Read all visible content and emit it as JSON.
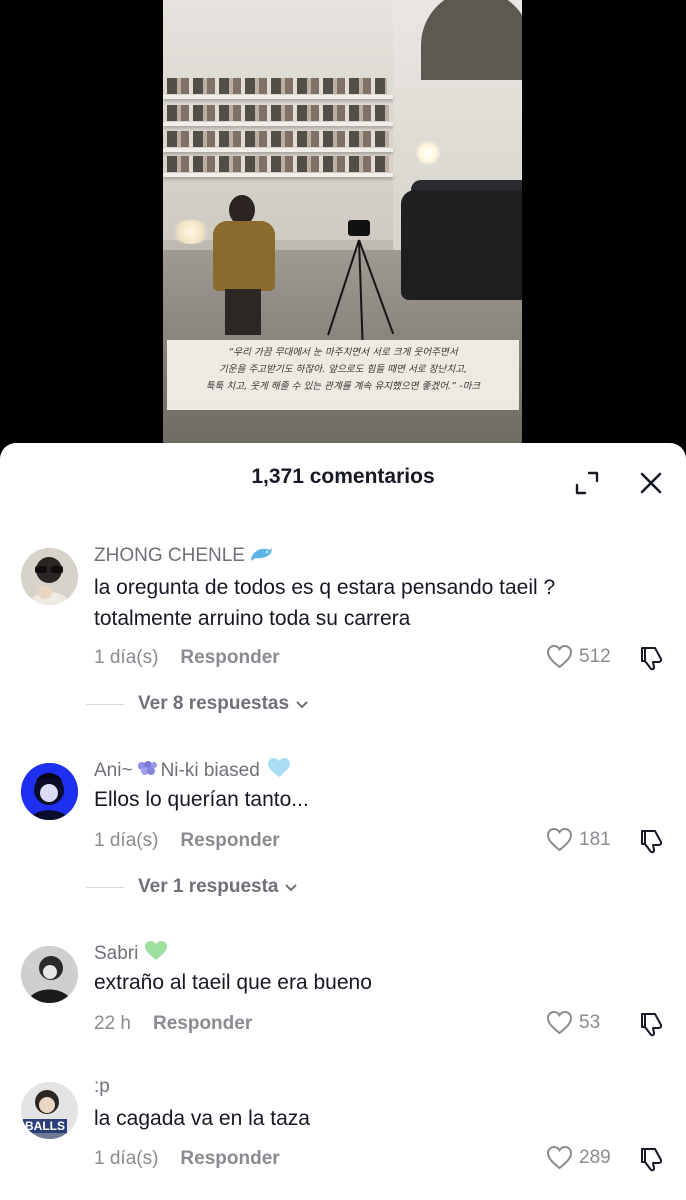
{
  "video": {
    "caption_lines": [
      "“우리 가끔 무대에서 눈 마주치면서 서로 크게 웃어주면서",
      "기운을 주고받기도 하잖아. 앞으로도 힘들 때면 서로 장난치고,",
      "툭툭 치고, 웃게 해줄 수 있는 관계를 계속 유지했으면 좋겠어.” -마크"
    ]
  },
  "comments_sheet": {
    "title": "1,371 comentarios",
    "icons": {
      "expand": "expand-icon",
      "close": "close-icon"
    }
  },
  "comments": [
    {
      "username": "ZHONG CHENLE",
      "badge": "dolphin-emoji",
      "text": "la oregunta de todos es q estara pensando taeil ? totalmente arruino toda su carrera",
      "time": "1 día(s)",
      "reply_label": "Responder",
      "likes": "512",
      "view_replies": "Ver 8 respuestas"
    },
    {
      "username": "Ani~",
      "username_suffix": "Ni-ki biased",
      "badge": "light-blue-heart-emoji",
      "text": "Ellos lo querían tanto...",
      "time": "1 día(s)",
      "reply_label": "Responder",
      "likes": "181",
      "view_replies": "Ver 1 respuesta"
    },
    {
      "username": "Sabri",
      "badge": "green-heart-emoji",
      "text": "extraño al taeil que era bueno",
      "time": "22 h",
      "reply_label": "Responder",
      "likes": "53"
    },
    {
      "username": ":p",
      "text": "la cagada va en la taza",
      "time": "1 día(s)",
      "reply_label": "Responder",
      "likes": "289",
      "avatar_text": "BALLS"
    }
  ],
  "colors": {
    "primary_text": "#161823",
    "secondary_text": "#8a8b91",
    "sheet_bg": "#ffffff",
    "backdrop": "#000000"
  }
}
